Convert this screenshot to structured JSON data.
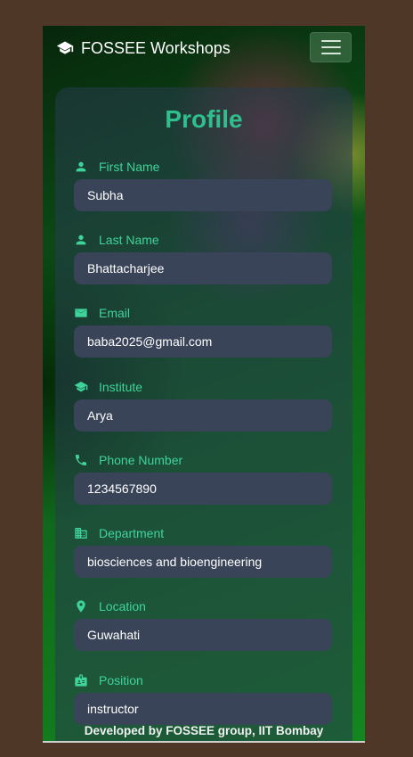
{
  "navbar": {
    "brand": "FOSSEE Workshops"
  },
  "profile": {
    "title": "Profile",
    "fields": [
      {
        "label": "First Name",
        "value": "Subha",
        "icon": "person-icon"
      },
      {
        "label": "Last Name",
        "value": "Bhattacharjee",
        "icon": "person-icon"
      },
      {
        "label": "Email",
        "value": "baba2025@gmail.com",
        "icon": "mail-icon"
      },
      {
        "label": "Institute",
        "value": "Arya",
        "icon": "school-icon"
      },
      {
        "label": "Phone Number",
        "value": "1234567890",
        "icon": "phone-icon"
      },
      {
        "label": "Department",
        "value": "biosciences and bioengineering",
        "icon": "building-icon"
      },
      {
        "label": "Location",
        "value": "Guwahati",
        "icon": "location-pin-icon"
      },
      {
        "label": "Position",
        "value": "instructor",
        "icon": "badge-icon"
      }
    ]
  },
  "footer": {
    "text": "Developed by FOSSEE group, IIT Bombay"
  },
  "colors": {
    "accent": "#3ed49b",
    "title": "#2fbf8c",
    "input_bg": "#3a4458",
    "page_bg": "#4e3727"
  }
}
